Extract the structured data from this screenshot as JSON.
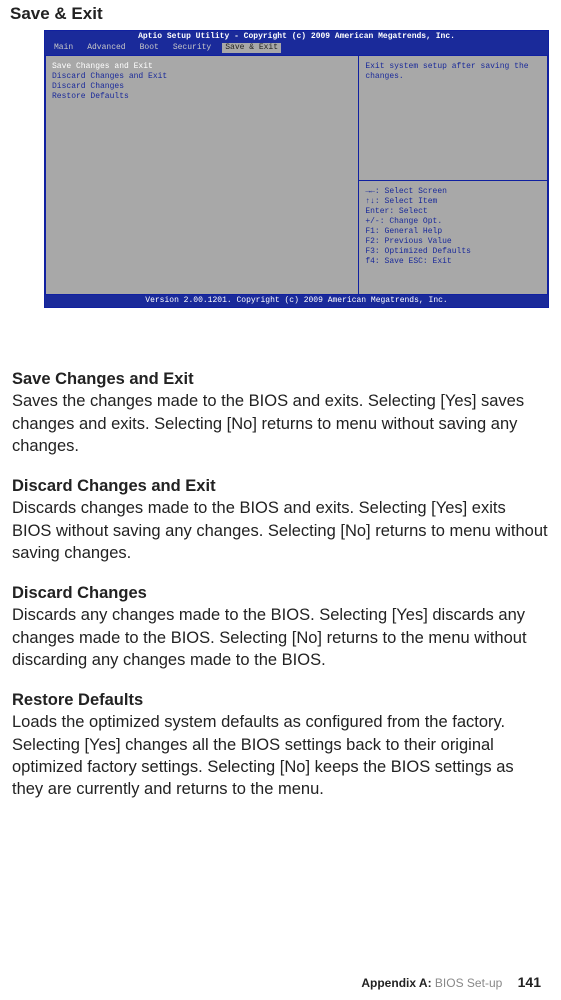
{
  "page_title": "Save & Exit",
  "bios": {
    "topbar": "Aptio Setup Utility - Copyright (c) 2009 American Megatrends, Inc.",
    "tabs": [
      "Main",
      "Advanced",
      "Boot",
      "Security",
      "Save & Exit"
    ],
    "active_tab_index": 4,
    "menu": {
      "items": [
        "Save Changes and Exit",
        "Discard Changes and Exit",
        "Discard Changes",
        "",
        "Restore Defaults"
      ],
      "selected_index": 0
    },
    "help_text": "Exit system setup after saving the changes.",
    "keyhelp": [
      "→←: Select Screen",
      "↑↓: Select Item",
      "Enter: Select",
      "+/-: Change Opt.",
      "F1: General Help",
      "F2: Previous Value",
      "F3: Optimized Defaults",
      "f4: Save  ESC: Exit"
    ],
    "bottombar": "Version 2.00.1201. Copyright (c) 2009 American Megatrends, Inc."
  },
  "sections": [
    {
      "heading": "Save Changes and Exit",
      "body": "Saves the changes made to the BIOS and exits. Selecting [Yes] saves changes and exits. Selecting [No] returns to menu without saving any changes."
    },
    {
      "heading": "Discard Changes and Exit",
      "body": "Discards changes made to the BIOS and exits. Selecting [Yes] exits BIOS without saving any changes. Selecting [No] returns to menu without saving changes."
    },
    {
      "heading": "Discard Changes",
      "body": "Discards any changes made to the BIOS. Selecting [Yes] discards any changes made to the BIOS. Selecting [No] returns to the menu without discarding any changes made to the BIOS."
    },
    {
      "heading": "Restore Defaults",
      "body": "Loads the optimized system defaults as configured from the factory. Selecting [Yes] changes all the BIOS settings back to their original optimized factory settings. Selecting [No] keeps the BIOS settings as they are currently and returns to the menu."
    }
  ],
  "footer": {
    "appendix_label": "Appendix A:",
    "appendix_title": "BIOS Set-up",
    "page_number": "141"
  }
}
